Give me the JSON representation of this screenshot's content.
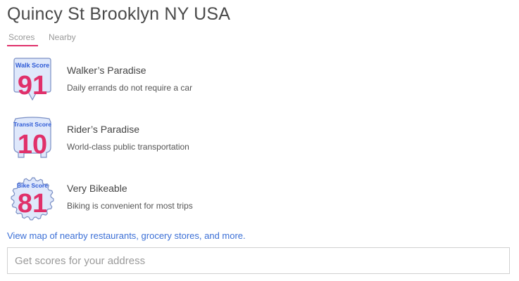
{
  "page": {
    "title": "Quincy St Brooklyn NY USA"
  },
  "tabs": [
    {
      "label": "Scores"
    },
    {
      "label": "Nearby"
    }
  ],
  "colors": {
    "accent": "#e0306a",
    "badge_fill": "#dfe8fb",
    "badge_stroke": "#7a8fc4",
    "badge_label": "#2f5bd6",
    "link": "#3b6fd6"
  },
  "scores": [
    {
      "badge_label": "Walk Score",
      "value": "91",
      "description": "Walker’s Paradise",
      "subtext": "Daily errands do not require a car",
      "icon": "walk-score-badge-icon"
    },
    {
      "badge_label": "Transit Score",
      "value": "10",
      "description": "Rider’s Paradise",
      "subtext": "World-class public transportation",
      "icon": "transit-score-badge-icon"
    },
    {
      "badge_label": "Bike Score",
      "value": "81",
      "description": "Very Bikeable",
      "subtext": "Biking is convenient for most trips",
      "icon": "bike-score-badge-icon"
    }
  ],
  "map_link": {
    "label": "View map of nearby restaurants, grocery stores, and more."
  },
  "address_search": {
    "value": "",
    "placeholder": "Get scores for your address"
  }
}
